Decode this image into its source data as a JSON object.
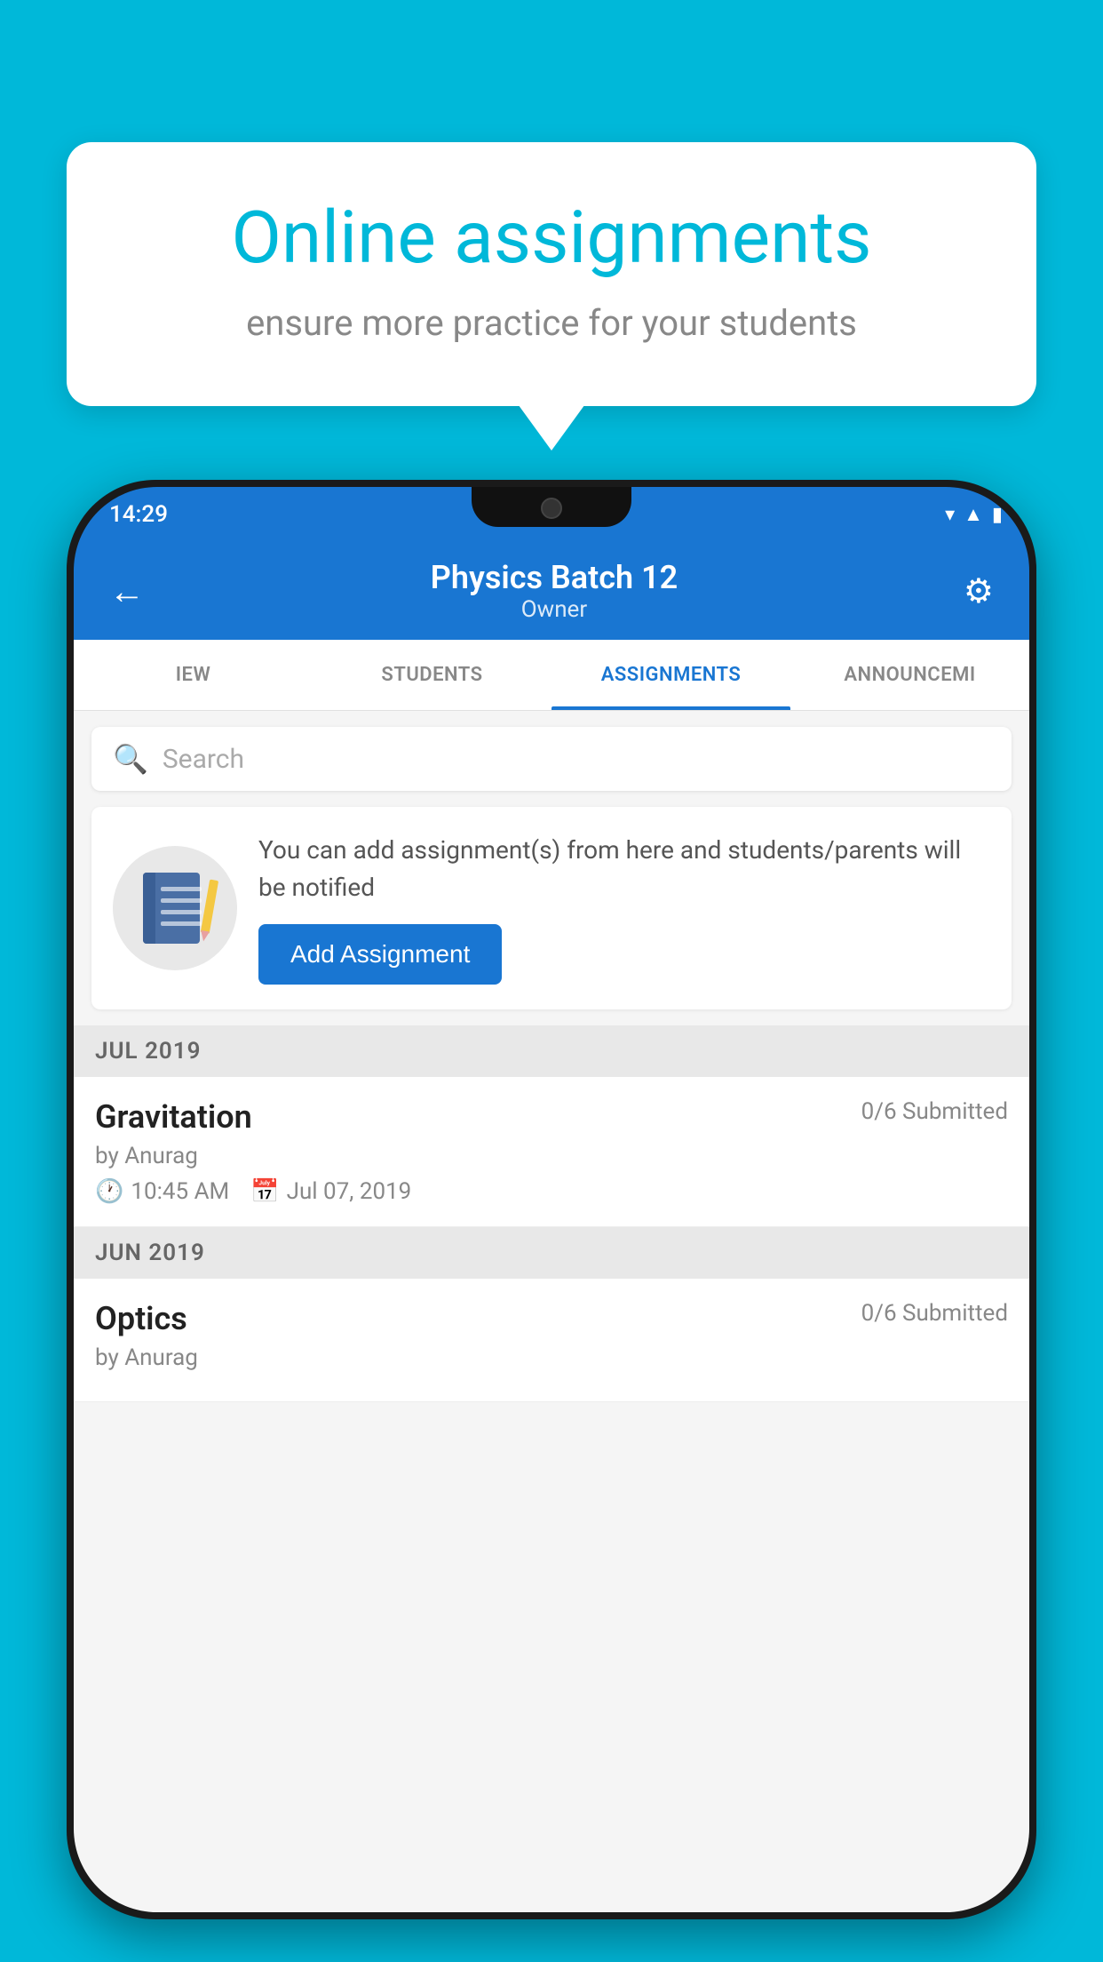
{
  "background_color": "#00b8d9",
  "speech_bubble": {
    "title": "Online assignments",
    "subtitle": "ensure more practice for your students"
  },
  "phone": {
    "status_bar": {
      "time": "14:29",
      "icons": [
        "wifi",
        "signal",
        "battery"
      ]
    },
    "app_bar": {
      "title": "Physics Batch 12",
      "subtitle": "Owner",
      "back_label": "←",
      "settings_label": "⚙"
    },
    "tabs": [
      {
        "label": "IEW",
        "active": false
      },
      {
        "label": "STUDENTS",
        "active": false
      },
      {
        "label": "ASSIGNMENTS",
        "active": true
      },
      {
        "label": "ANNOUNCEMI",
        "active": false
      }
    ],
    "search": {
      "placeholder": "Search"
    },
    "promo": {
      "description": "You can add assignment(s) from here and students/parents will be notified",
      "add_button_label": "Add Assignment"
    },
    "sections": [
      {
        "header": "JUL 2019",
        "assignments": [
          {
            "title": "Gravitation",
            "submitted": "0/6 Submitted",
            "by": "by Anurag",
            "time": "10:45 AM",
            "date": "Jul 07, 2019"
          }
        ]
      },
      {
        "header": "JUN 2019",
        "assignments": [
          {
            "title": "Optics",
            "submitted": "0/6 Submitted",
            "by": "by Anurag",
            "time": "",
            "date": ""
          }
        ]
      }
    ]
  }
}
